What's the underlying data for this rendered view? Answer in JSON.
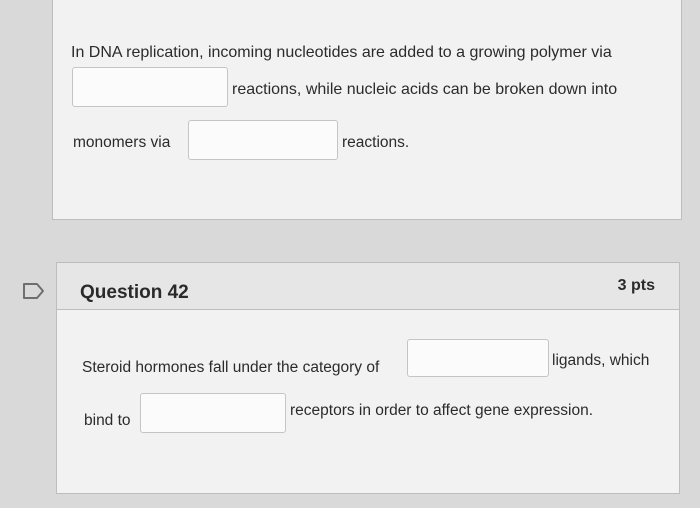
{
  "question_41": {
    "line1": "In DNA replication, incoming nucleotides are added to a growing polymer via",
    "after_blank1": "reactions, while nucleic acids can be broken down into",
    "before_blank2": "monomers via",
    "after_blank2": "reactions.",
    "blank1_value": "",
    "blank2_value": ""
  },
  "question_42": {
    "title": "Question 42",
    "points": "3 pts",
    "before_blank1": "Steroid hormones fall under the category of",
    "after_blank1": "ligands, which",
    "before_blank2": "bind to",
    "after_blank2": "receptors in order to affect gene expression.",
    "blank1_value": "",
    "blank2_value": ""
  },
  "icons": {
    "flag": "flag-outline-icon"
  }
}
